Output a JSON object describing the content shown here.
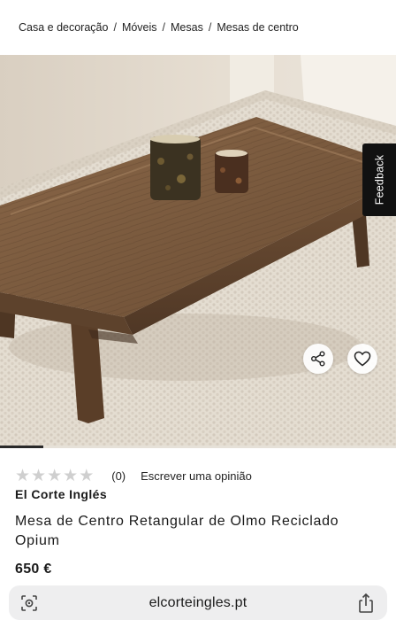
{
  "breadcrumb": {
    "items": [
      "Casa e decoração",
      "Móveis",
      "Mesas",
      "Mesas de centro"
    ],
    "separator": "/"
  },
  "gallery": {
    "progress_fraction": 0.11,
    "feedback_label": "Feedback",
    "share_icon": "share-icon",
    "favorite_icon": "heart-icon"
  },
  "product": {
    "rating_stars": 0,
    "rating_max": 5,
    "review_count": "(0)",
    "write_review": "Escrever uma opinião",
    "brand": "El Corte Inglés",
    "title": "Mesa de Centro Retangular de Olmo Reciclado Opium",
    "price": "650 €"
  },
  "browser": {
    "url": "elcorteingles.pt",
    "left_icon": "page-settings-icon",
    "right_icon": "share-upload-icon"
  },
  "colors": {
    "star_empty": "#cfcfcf",
    "feedback_bg": "#111111",
    "urlbar_bg": "#eeeeef"
  }
}
